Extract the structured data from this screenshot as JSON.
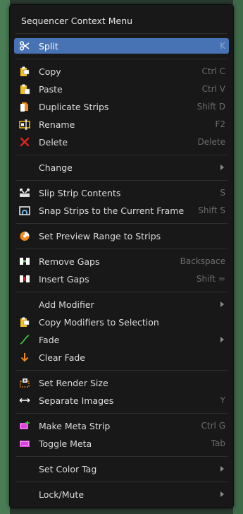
{
  "menu": {
    "title": "Sequencer Context Menu",
    "items": [
      {
        "label": "Split",
        "shortcut": "K"
      },
      {
        "label": "Copy",
        "shortcut": "Ctrl C"
      },
      {
        "label": "Paste",
        "shortcut": "Ctrl V"
      },
      {
        "label": "Duplicate Strips",
        "shortcut": "Shift D"
      },
      {
        "label": "Rename",
        "shortcut": "F2"
      },
      {
        "label": "Delete",
        "shortcut": "Delete"
      },
      {
        "label": "Change"
      },
      {
        "label": "Slip Strip Contents",
        "shortcut": "S"
      },
      {
        "label": "Snap Strips to the Current Frame",
        "shortcut": "Shift S"
      },
      {
        "label": "Set Preview Range to Strips"
      },
      {
        "label": "Remove Gaps",
        "shortcut": "Backspace"
      },
      {
        "label": "Insert Gaps",
        "shortcut": "Shift ="
      },
      {
        "label": "Add Modifier"
      },
      {
        "label": "Copy Modifiers to Selection"
      },
      {
        "label": "Fade"
      },
      {
        "label": "Clear Fade"
      },
      {
        "label": "Set Render Size"
      },
      {
        "label": "Separate Images",
        "shortcut": "Y"
      },
      {
        "label": "Make Meta Strip",
        "shortcut": "Ctrl G"
      },
      {
        "label": "Toggle Meta",
        "shortcut": "Tab"
      },
      {
        "label": "Set Color Tag"
      },
      {
        "label": "Lock/Mute"
      }
    ]
  },
  "icons": {
    "split": "scissors-icon",
    "copy": "clipboard-copy-icon",
    "paste": "clipboard-paste-icon",
    "duplicate": "duplicate-icon",
    "rename": "rename-icon",
    "delete": "x-delete-icon",
    "slip": "slip-strip-icon",
    "snap": "snap-icon",
    "preview_range": "preview-range-icon",
    "remove_gaps": "remove-gaps-icon",
    "insert_gaps": "insert-gaps-icon",
    "copy_modifiers": "clipboard-copy-icon",
    "fade": "fade-curve-icon",
    "clear_fade": "down-arrow-icon",
    "render_size": "render-size-icon",
    "separate": "separate-arrows-icon",
    "make_meta": "make-meta-icon",
    "toggle_meta": "toggle-meta-icon"
  },
  "colors": {
    "menu_bg": "#181818",
    "highlight": "#4772b3",
    "text": "#dcdcdc",
    "shortcut": "#6c6c6c",
    "delete_red": "#e02020",
    "clipboard_yellow": "#f0c020",
    "orange": "#f08a1a",
    "meta_magenta": "#e040e0"
  }
}
